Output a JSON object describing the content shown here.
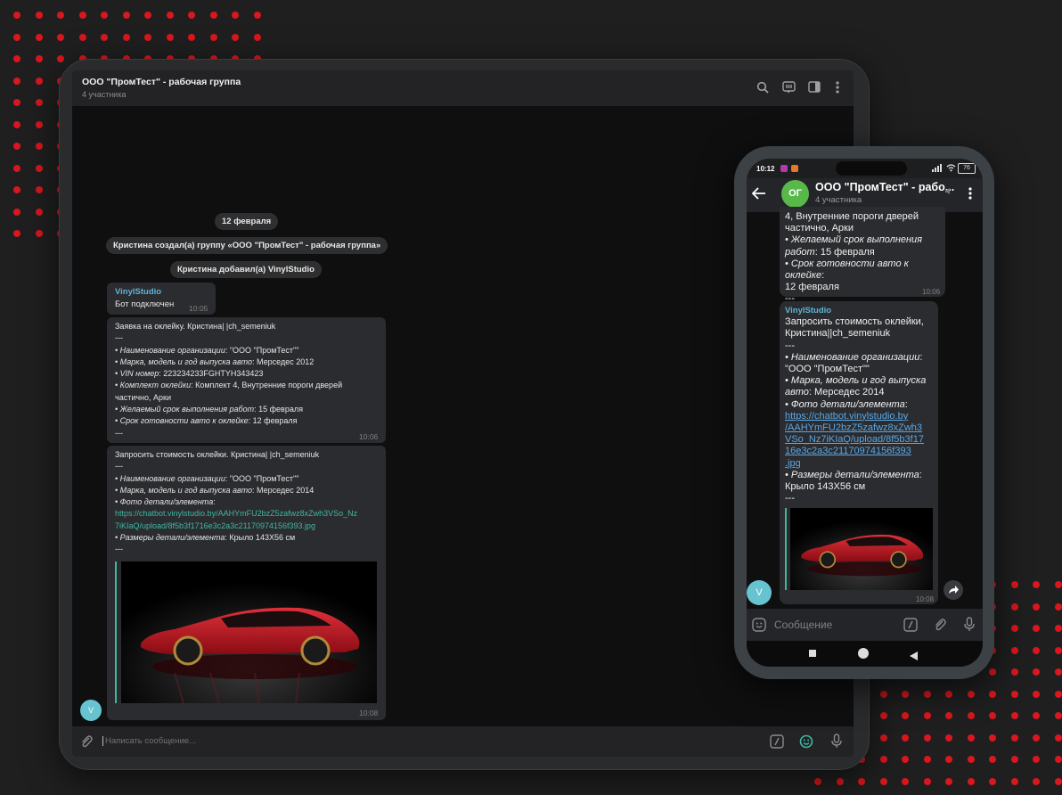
{
  "desktop": {
    "header": {
      "title": "ООО \"ПромТест\" - рабочая группа",
      "subtitle": "4 участника",
      "icons": [
        "search-icon",
        "chat-icon",
        "sidebar-icon",
        "more-icon"
      ]
    },
    "service": {
      "date": "12 февраля",
      "created": "Кристина создал(а) группу «ООО \"ПромТест\" - рабочая группа»",
      "added": "Кристина добавил(а) VinylStudio"
    },
    "msg1": {
      "sender": "VinylStudio",
      "text": "Бот подключен",
      "time": "10:05"
    },
    "msg2": {
      "title": "Заявка на оклейку. Кристина| |ch_semeniuk",
      "sep": "---",
      "org_label": "• Наименование организации",
      "org_value": ": \"ООО \"ПромТест\"\"",
      "model_label": "• Марка, модель и год выпуска авто",
      "model_value": ": Мерседес 2012",
      "vin_label": "• VIN номер",
      "vin_value": ": 223234233FGHTYH343423",
      "kit_label": "• Комплект оклейки",
      "kit_value": ": Комплект 4, Внутренние пороги дверей",
      "kit_value2": "частично, Арки",
      "term_label": "• Желаемый срок выполнения работ",
      "term_value": ": 15 февраля",
      "ready_label": "• Срок готовности авто к оклейке",
      "ready_value": ": 12 февраля",
      "end": "---",
      "time": "10:06"
    },
    "msg3": {
      "title": "Запросить стоимость оклейки. Кристина| |ch_semeniuk",
      "sep": "---",
      "org_label": "• Наименование организации",
      "org_value": ": \"ООО \"ПромТест\"\"",
      "model_label": "• Марка, модель и год выпуска авто",
      "model_value": ": Мерседес 2014",
      "photo_label": "• Фото детали/элемента",
      "photo_value": ":",
      "link1": "https://chatbot.vinylstudio.by/AAHYmFU2bzZ5zafwz8xZwh3VSo_Nz",
      "link2": "7iKIaQ/upload/8f5b3f1716e3c2a3c21170974156f393.jpg",
      "size_label": "• Размеры детали/элемента",
      "size_value": ": Крыло 143Х56 см",
      "end": "---",
      "time": "10:08"
    },
    "avatar": "V",
    "input_placeholder": "Написать сообщение..."
  },
  "phone": {
    "status": {
      "time": "10:12",
      "battery": "76"
    },
    "header": {
      "avatar": "ОГ",
      "title": "ООО \"ПромТест\" - рабо...",
      "subtitle": "4 участника"
    },
    "prev": {
      "l1": "4, Внутренние пороги дверей",
      "l2": "частично, Арки",
      "term_label": "• Желаемый срок выполнения",
      "term_label2": "работ",
      "term_value": ": 15 февраля",
      "ready_label": "• Срок готовности авто к оклейке",
      "ready_value": ":",
      "ready_value2": "12 февраля",
      "end": "---",
      "time": "10:06"
    },
    "msg": {
      "sender": "VinylStudio",
      "title1": "Запросить стоимость оклейки,",
      "title2": "Кристина||ch_semeniuk",
      "sep": "---",
      "org_label": "• Наименование организации",
      "org_value": ":",
      "org_value2": "\"ООО \"ПромТест\"\"",
      "model_label": "• Марка, модель и год выпуска",
      "model_label2": "авто",
      "model_value": ": Мерседес 2014",
      "photo_label": "• Фото детали/элемента",
      "photo_value": ":",
      "link1": "https://chatbot.vinylstudio.by",
      "link2": "/AAHYmFU2bzZ5zafwz8xZwh3",
      "link3": "VSo_Nz7iKIaQ/upload/8f5b3f17",
      "link4": "16e3c2a3c21170974156f393",
      "link5": ".jpg",
      "size_label": "• Размеры детали/элемента",
      "size_value": ":",
      "size_value2": "Крыло 143Х56 см",
      "end": "---",
      "time": "10:08"
    },
    "avatar": "V",
    "input_placeholder": "Сообщение"
  },
  "colors": {
    "accent": "#d8171e",
    "link": "#3fb7a2",
    "sender": "#5fb4d6"
  }
}
